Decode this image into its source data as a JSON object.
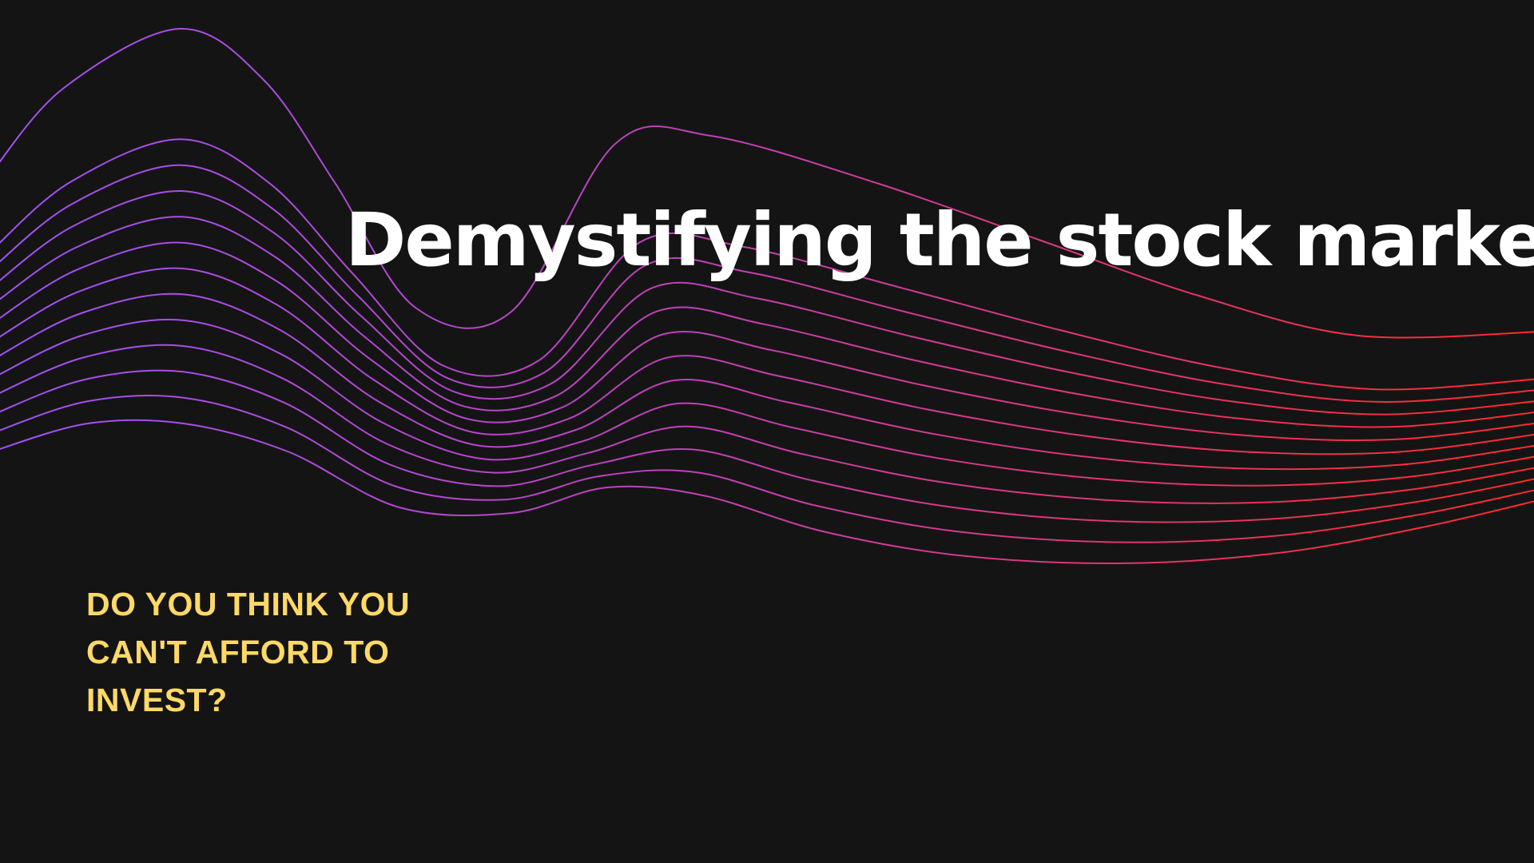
{
  "slide": {
    "title": "Demystifying the stock market",
    "subtitle": "DO YOU THINK YOU CAN'T AFFORD TO INVEST?"
  },
  "colors": {
    "background": "#141414",
    "title": "#ffffff",
    "subtitle": "#ffd966",
    "wave_start": "#a052f5",
    "wave_mid": "#c040b8",
    "wave_end": "#ff2a2a"
  }
}
